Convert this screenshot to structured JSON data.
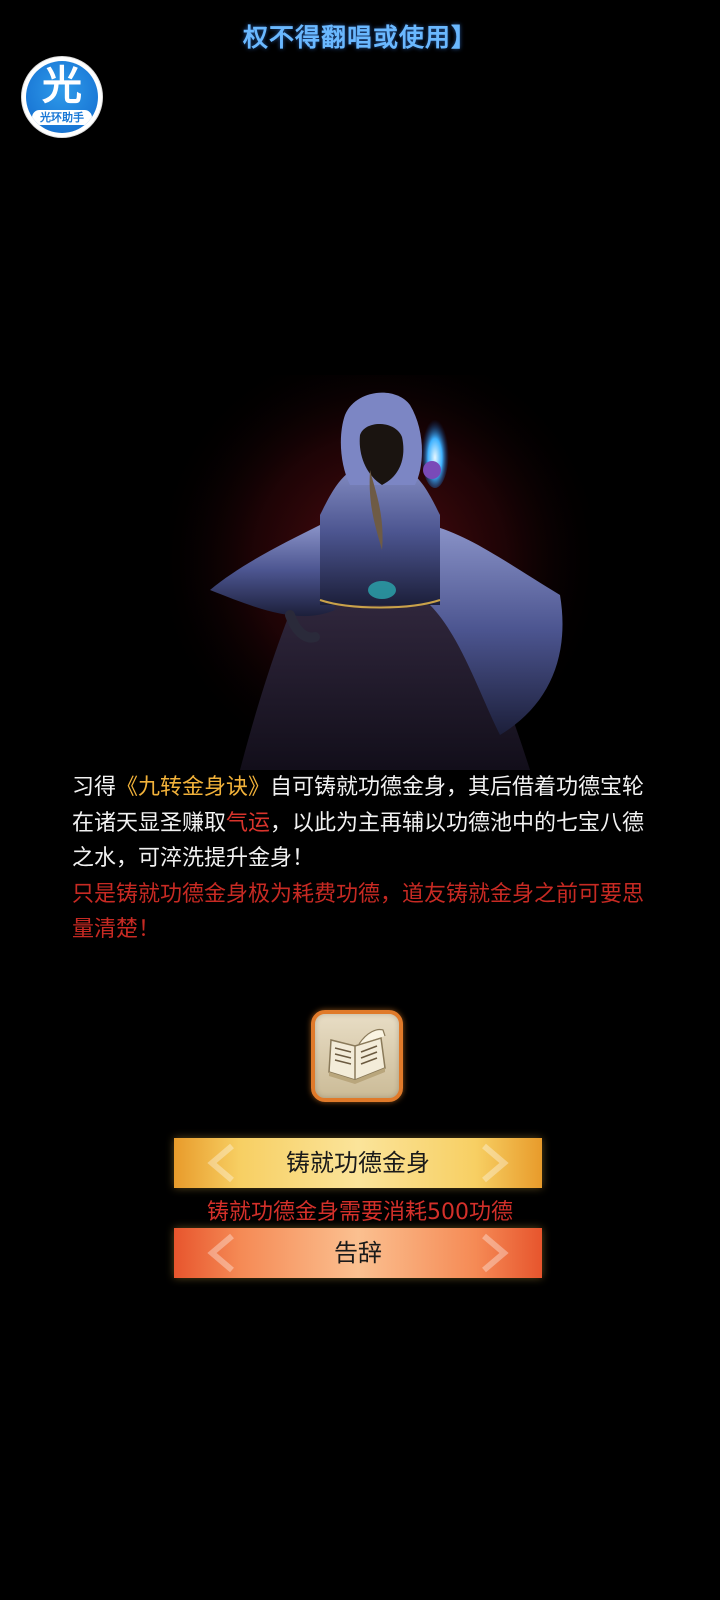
{
  "banner": {
    "text": "权不得翻唱或使用】"
  },
  "assistant_badge": {
    "glyph": "光",
    "caption": "光环助手"
  },
  "story": {
    "line1_pre": "习得",
    "book_title": "《九转金身诀》",
    "line1_post": "自可铸就功德金身，其后借着功德宝轮在诸天显圣赚取",
    "luck": "气运",
    "line2_post": "，以此为主再辅以功德池中的七宝八德之水，可淬洗提升金身！",
    "warning": "只是铸就功德金身极为耗费功德，道友铸就金身之前可要思量清楚！"
  },
  "item": {
    "icon": "scroll-book-icon"
  },
  "actions": {
    "forge_label": "铸就功德金身",
    "cost_note": "铸就功德金身需要消耗500功德",
    "leave_label": "告辞"
  },
  "colors": {
    "highlight_gold": "#f2b23a",
    "highlight_red": "#d9342c",
    "warning_red": "#c72a23",
    "banner_blue": "#6ab8ff"
  }
}
